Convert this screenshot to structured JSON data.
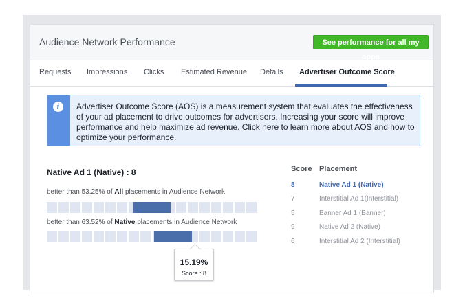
{
  "header": {
    "title": "Audience Network Performance",
    "action_button": "See performance for all my apps"
  },
  "tabs": [
    {
      "label": "Requests",
      "active": false
    },
    {
      "label": "Impressions",
      "active": false
    },
    {
      "label": "Clicks",
      "active": false
    },
    {
      "label": "Estimated Revenue",
      "active": false
    },
    {
      "label": "Details",
      "active": false
    },
    {
      "label": "Advertiser Outcome Score",
      "active": true
    }
  ],
  "info": {
    "icon": "info-icon",
    "text": "Advertiser Outcome Score (AOS) is a measurement system that evaluates the effectiveness of your ad placement to drive outcomes for advertisers. Increasing your score will improve performance and help maximize ad revenue. Click here to learn more about AOS and how to optimize your performance."
  },
  "score_panel": {
    "title": "Native Ad 1 (Native) : 8",
    "all": {
      "prefix": "better than 53.25% of ",
      "emphasis": "All",
      "suffix": " placements in Audience Network",
      "percent": 53.25
    },
    "native": {
      "prefix": "better than 63.52% of ",
      "emphasis": "Native",
      "suffix": " placements in Audience Network",
      "percent": 63.52
    },
    "tooltip": {
      "value": "15.19%",
      "label": "Score : 8"
    }
  },
  "placements": {
    "headers": {
      "score": "Score",
      "placement": "Placement"
    },
    "rows": [
      {
        "score": "8",
        "name": "Native Ad 1 (Native)",
        "selected": true
      },
      {
        "score": "7",
        "name": "Interstitial Ad 1(Interstitial)",
        "selected": false
      },
      {
        "score": "5",
        "name": "Banner Ad 1 (Banner)",
        "selected": false
      },
      {
        "score": "9",
        "name": "Native Ad 2 (Native)",
        "selected": false
      },
      {
        "score": "6",
        "name": "Interstitial Ad 2 (Interstitial)",
        "selected": false
      }
    ]
  },
  "colors": {
    "accent": "#4267b2",
    "button_green": "#42b72a",
    "bar_fill": "#4a6ea9",
    "bar_empty": "#dfe6f1",
    "info_stripe": "#5b8fe2"
  }
}
